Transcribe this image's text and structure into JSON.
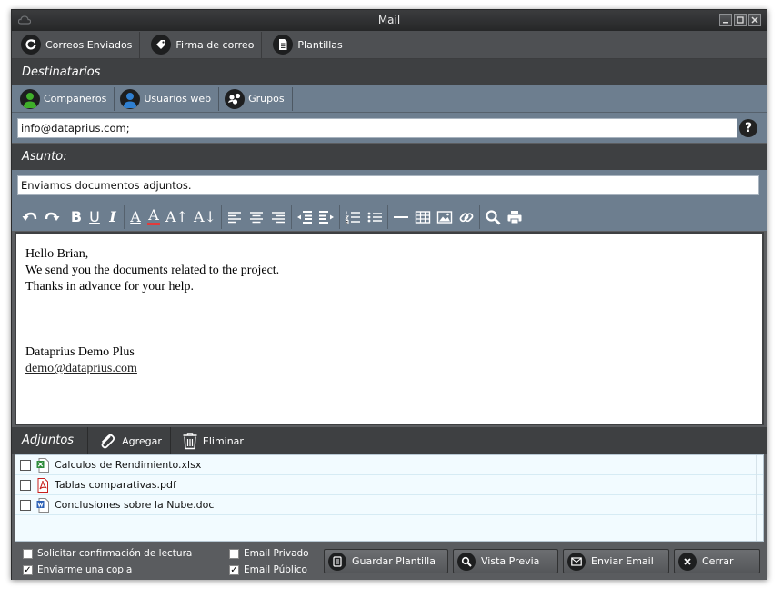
{
  "window": {
    "title": "Mail"
  },
  "top_toolbar": [
    {
      "label": "Correos Enviados",
      "icon": "refresh-icon"
    },
    {
      "label": "Firma de correo",
      "icon": "tag-icon"
    },
    {
      "label": "Plantillas",
      "icon": "document-icon"
    }
  ],
  "recipients": {
    "header": "Destinatarios",
    "buttons": [
      {
        "label": "Compañeros",
        "icon": "person-green-icon",
        "color": "#3fae2a"
      },
      {
        "label": "Usuarios web",
        "icon": "person-blue-icon",
        "color": "#2f7fd0"
      },
      {
        "label": "Grupos",
        "icon": "group-icon",
        "color": "#ffffff"
      }
    ],
    "to_value": "info@dataprius.com;"
  },
  "subject": {
    "header": "Asunto:",
    "value": "Enviamos documentos adjuntos."
  },
  "body": {
    "lines": [
      "Hello Brian,",
      "We send you the documents related to the project.",
      "Thanks in advance for your help.",
      "",
      "",
      "",
      "Dataprius Demo Plus"
    ],
    "signature_email": "demo@dataprius.com"
  },
  "attachments": {
    "header": "Adjuntos",
    "add_label": "Agregar",
    "delete_label": "Eliminar",
    "files": [
      {
        "name": "Calculos de Rendimiento.xlsx",
        "type": "excel",
        "color": "#2e8b3a"
      },
      {
        "name": "Tablas comparativas.pdf",
        "type": "pdf",
        "color": "#c8201e"
      },
      {
        "name": "Conclusiones sobre la Nube.doc",
        "type": "word",
        "color": "#2b5fb4"
      }
    ]
  },
  "footer": {
    "options": {
      "read_receipt": {
        "label": "Solicitar confirmación de lectura",
        "checked": false
      },
      "send_copy": {
        "label": "Enviarme una copia",
        "checked": true
      },
      "private": {
        "label": "Email Privado",
        "checked": false
      },
      "public": {
        "label": "Email Público",
        "checked": true
      }
    },
    "buttons": {
      "save_template": "Guardar Plantilla",
      "preview": "Vista Previa",
      "send": "Enviar Email",
      "close": "Cerrar"
    }
  }
}
